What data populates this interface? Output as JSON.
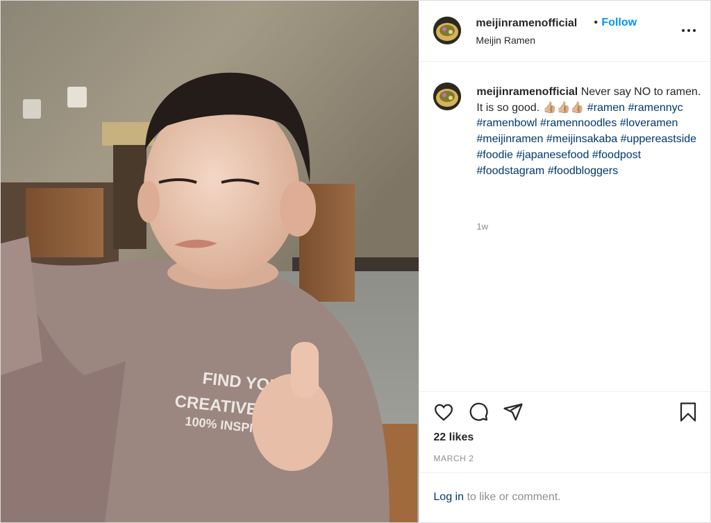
{
  "post": {
    "photo_description_icon": "photo",
    "shirt_text": {
      "line1": "FIND YOUR",
      "line2": "CREATIVE S",
      "line3": "100% INSPI"
    }
  },
  "header": {
    "username": "meijinramenofficial",
    "separator": "•",
    "follow_label": "Follow",
    "location": "Meijin Ramen",
    "more_icon": "more-options-icon"
  },
  "caption": {
    "username": "meijinramenofficial",
    "text_before": "Never say NO to ramen. It is so good. 👍🏼👍🏼👍🏼",
    "hashtags": [
      "#ramen",
      "#ramennyc",
      "#ramenbowl",
      "#ramennoodles",
      "#loveramen",
      "#meijinramen",
      "#meijinsakaba",
      "#uppereastside",
      "#foodie",
      "#japanesefood",
      "#foodpost",
      "#foodstagram",
      "#foodbloggers"
    ],
    "time": "1w"
  },
  "actions": {
    "like_icon": "heart-icon",
    "comment_icon": "comment-icon",
    "share_icon": "share-icon",
    "save_icon": "bookmark-icon",
    "likes": "22 likes",
    "date": "MARCH 2"
  },
  "login": {
    "link": "Log in",
    "text": " to like or comment."
  },
  "colors": {
    "link_blue": "#0095f6",
    "hashtag": "#00376b",
    "muted": "#8e8e8e",
    "border": "#dbdbdb"
  }
}
